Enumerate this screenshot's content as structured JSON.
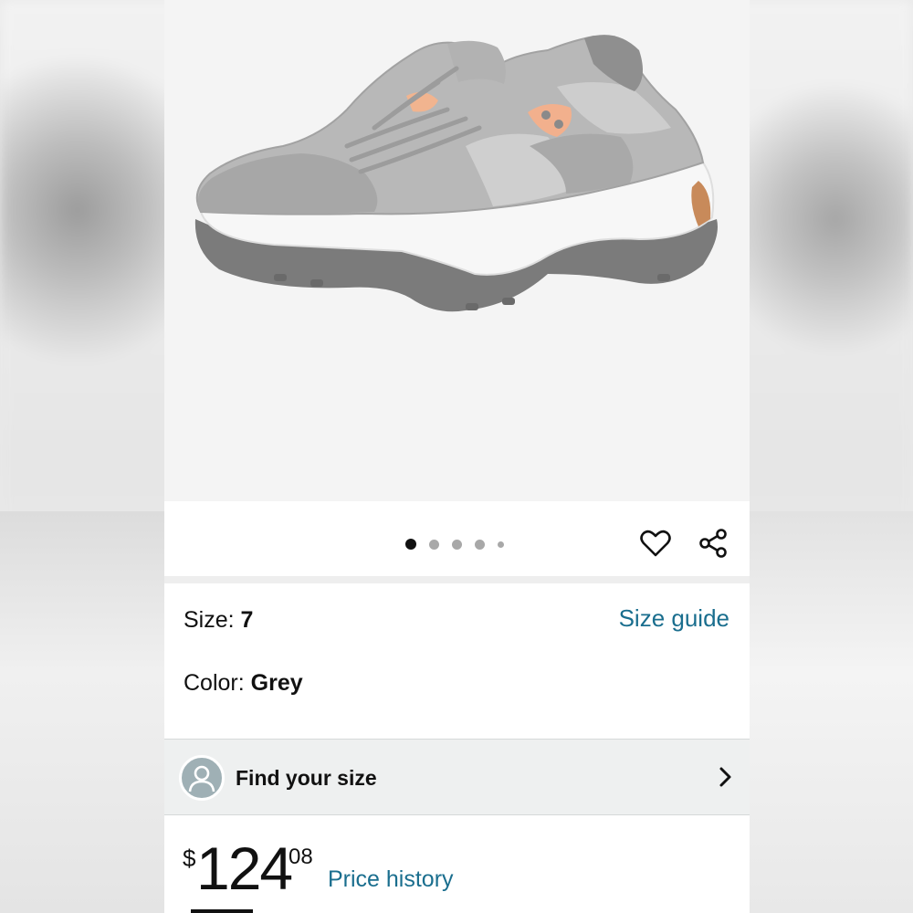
{
  "product": {
    "image_alt": "grey-suede-sneaker",
    "carousel": {
      "count": 5,
      "active_index": 0
    }
  },
  "actions": {
    "favorite_icon": "heart-icon",
    "share_icon": "share-icon"
  },
  "variation": {
    "size_label": "Size: ",
    "size_value": "7",
    "size_guide_link": "Size guide",
    "color_label": "Color: ",
    "color_value": "Grey"
  },
  "fit_finder": {
    "label": "Find your size",
    "avatar_icon": "user-icon",
    "chevron_icon": "chevron-right-icon"
  },
  "price": {
    "currency": "$",
    "whole": "124",
    "fraction": "08",
    "history_link": "Price history"
  },
  "colors": {
    "link": "#1a6e8e",
    "text": "#111111",
    "divider": "#eeeeee",
    "fit_bg": "#eef0f0"
  }
}
